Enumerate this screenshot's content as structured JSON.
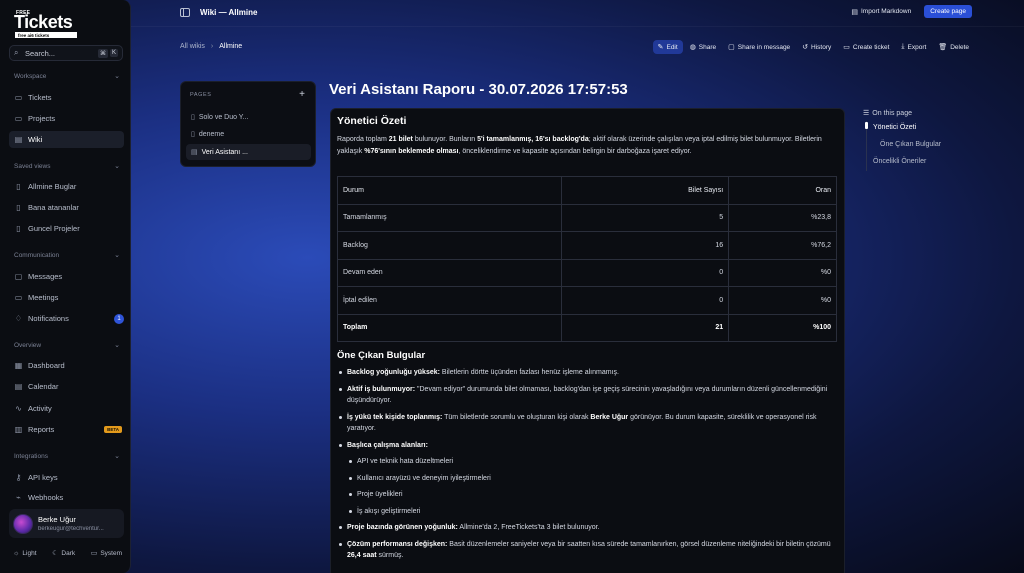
{
  "sidebar": {
    "logo": {
      "free": "FREE",
      "name": "Tickets",
      "tagline": "free ai6 tickets"
    },
    "search": {
      "placeholder": "Search...",
      "kbd1": "⌘",
      "kbd2": "K"
    },
    "sections": [
      {
        "title": "Workspace",
        "items": [
          {
            "label": "Tickets",
            "icon": "ticket-icon"
          },
          {
            "label": "Projects",
            "icon": "folder-icon"
          },
          {
            "label": "Wiki",
            "icon": "book-icon",
            "active": true
          }
        ]
      },
      {
        "title": "Saved views",
        "items": [
          {
            "label": "Allmine Buglar",
            "icon": "bookmark-icon"
          },
          {
            "label": "Bana atananlar",
            "icon": "bookmark-icon"
          },
          {
            "label": "Guncel Projeler",
            "icon": "bookmark-icon"
          }
        ]
      },
      {
        "title": "Communication",
        "items": [
          {
            "label": "Messages",
            "icon": "chat-icon"
          },
          {
            "label": "Meetings",
            "icon": "video-icon"
          },
          {
            "label": "Notifications",
            "icon": "bell-icon",
            "badge": "1"
          }
        ]
      },
      {
        "title": "Overview",
        "items": [
          {
            "label": "Dashboard",
            "icon": "grid-icon"
          },
          {
            "label": "Calendar",
            "icon": "calendar-icon"
          },
          {
            "label": "Activity",
            "icon": "activity-icon"
          },
          {
            "label": "Reports",
            "icon": "chart-icon",
            "badge": "BETA"
          }
        ]
      },
      {
        "title": "Integrations",
        "items": [
          {
            "label": "API keys",
            "icon": "key-icon"
          },
          {
            "label": "Webhooks",
            "icon": "webhook-icon"
          }
        ]
      }
    ],
    "user": {
      "name": "Berke Uğur",
      "email": "berkeugur@techventur..."
    },
    "theme": {
      "light": "Light",
      "dark": "Dark",
      "system": "System"
    }
  },
  "topbar": {
    "title": "Wiki — Allmine",
    "import_label": "Import Markdown",
    "create_label": "Create page"
  },
  "breadcrumb": {
    "root": "All wikis",
    "sep": "›",
    "current": "Allmine"
  },
  "page_actions": {
    "edit": "Edit",
    "share": "Share",
    "share_msg": "Share in message",
    "history": "History",
    "create_ticket": "Create ticket",
    "export": "Export",
    "delete": "Delete"
  },
  "pages_panel": {
    "title": "PAGES",
    "plus": "+",
    "items": [
      "Solo ve Duo Y...",
      "deneme",
      "Veri Asistanı ..."
    ]
  },
  "doc": {
    "title": "Veri Asistanı Raporu - 30.07.2026 17:57:53",
    "summary_heading": "Yönetici Özeti",
    "intro": {
      "t1": "Raporda toplam ",
      "b1": "21 bilet",
      "t2": " bulunuyor. Bunların ",
      "b2": "5'i tamamlanmış, 16'sı backlog'da",
      "t3": "; aktif olarak üzerinde çalışılan veya iptal edilmiş bilet bulunmuyor. Biletlerin yaklaşık ",
      "b3": "%76'sının beklemede olması",
      "t4": ", önceliklendirme ve kapasite açısından belirgin bir darboğaza işaret ediyor."
    },
    "table": {
      "headers": [
        "Durum",
        "Bilet Sayısı",
        "Oran"
      ],
      "rows": [
        [
          "Tamamlanmış",
          "5",
          "%23,8"
        ],
        [
          "Backlog",
          "16",
          "%76,2"
        ],
        [
          "Devam eden",
          "0",
          "%0"
        ],
        [
          "İptal edilen",
          "0",
          "%0"
        ]
      ],
      "total": [
        "Toplam",
        "21",
        "%100"
      ]
    },
    "findings_heading": "Öne Çıkan Bulgular",
    "bullets": {
      "b1_bold": "Backlog yoğunluğu yüksek:",
      "b1_text": " Biletlerin dörtte üçünden fazlası henüz işleme alınmamış.",
      "b2_bold": "Aktif iş bulunmuyor:",
      "b2_text": " \"Devam ediyor\" durumunda bilet olmaması, backlog'dan işe geçiş sürecinin yavaşladığını veya durumların düzenli güncellenmediğini düşündürüyor.",
      "b3_bold": "İş yükü tek kişide toplanmış:",
      "b3_text": " Tüm biletlerde sorumlu ve oluşturan kişi olarak ",
      "b3_name": "Berke Uğur",
      "b3_text2": " görünüyor. Bu durum kapasite, süreklilik ve operasyonel risk yaratıyor.",
      "b4_bold": "Başlıca çalışma alanları:",
      "sub": [
        "API ve teknik hata düzeltmeleri",
        "Kullanıcı arayüzü ve deneyim iyileştirmeleri",
        "Proje üyelikleri",
        "İş akışı geliştirmeleri"
      ],
      "b5_bold": "Proje bazında görünen yoğunluk:",
      "b5_text": " Allmine'da 2, FreeTickets'ta 3 bilet bulunuyor.",
      "b6_bold": "Çözüm performansı değişken:",
      "b6_text": " Basit düzenlemeler saniyeler veya bir saatten kısa sürede tamamlanırken, görsel düzenleme niteliğindeki bir biletin çözümü ",
      "b6_b2": "26,4 saat",
      "b6_text2": " sürmüş."
    }
  },
  "toc": {
    "title": "On this page",
    "items": [
      "Yönetici Özeti",
      "Öne Çıkan Bulgular",
      "Öncelikli Öneriler"
    ]
  },
  "colors": {
    "accent": "#2a4fd6",
    "badge": "#2f54d8",
    "beta": "#e39a1c",
    "panel": "#0b0d12"
  }
}
